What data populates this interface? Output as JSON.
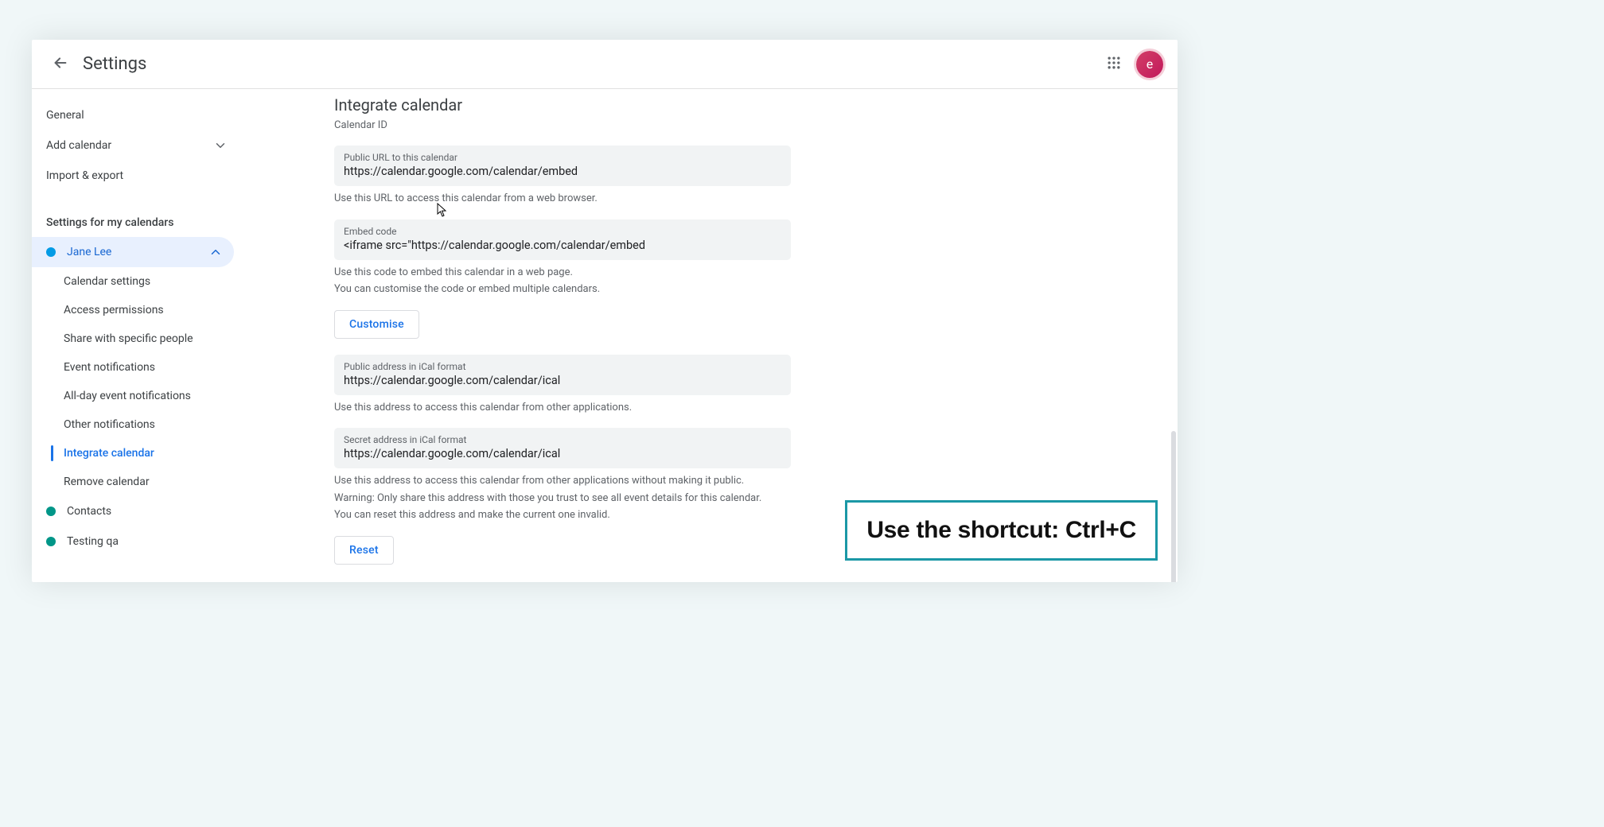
{
  "header": {
    "title": "Settings",
    "avatar_letter": "e"
  },
  "sidebar": {
    "general": "General",
    "add_calendar": "Add calendar",
    "import_export": "Import & export",
    "settings_for_my_calendars": "Settings for my calendars",
    "calendars": [
      {
        "name": "Jane Lee",
        "color": "#039be5",
        "expanded": true
      },
      {
        "name": "Contacts",
        "color": "#009688",
        "expanded": false
      },
      {
        "name": "Testing qa",
        "color": "#009688",
        "expanded": false
      }
    ],
    "sub_items": [
      "Calendar settings",
      "Access permissions",
      "Share with specific people",
      "Event notifications",
      "All-day event notifications",
      "Other notifications",
      "Integrate calendar",
      "Remove calendar"
    ],
    "active_sub_index": 6
  },
  "content": {
    "section_title": "Integrate calendar",
    "calendar_id_label": "Calendar ID",
    "public_url": {
      "label": "Public URL to this calendar",
      "value": "https://calendar.google.com/calendar/embed",
      "helper": "Use this URL to access this calendar from a web browser."
    },
    "embed_code": {
      "label": "Embed code",
      "value": "<iframe src=\"https://calendar.google.com/calendar/embed",
      "helper1": "Use this code to embed this calendar in a web page.",
      "helper2": "You can customise the code or embed multiple calendars.",
      "button": "Customise"
    },
    "ical_public": {
      "label": "Public address in iCal format",
      "value": "https://calendar.google.com/calendar/ical",
      "helper": "Use this address to access this calendar from other applications."
    },
    "ical_secret": {
      "label": "Secret address in iCal format",
      "value": "https://calendar.google.com/calendar/ical",
      "helper1": "Use this address to access this calendar from other applications without making it public.",
      "helper2": "Warning: Only share this address with those you trust to see all event details for this calendar.",
      "helper3": "You can reset this address and make the current one invalid.",
      "button": "Reset"
    }
  },
  "tip": "Use the shortcut: Ctrl+C"
}
